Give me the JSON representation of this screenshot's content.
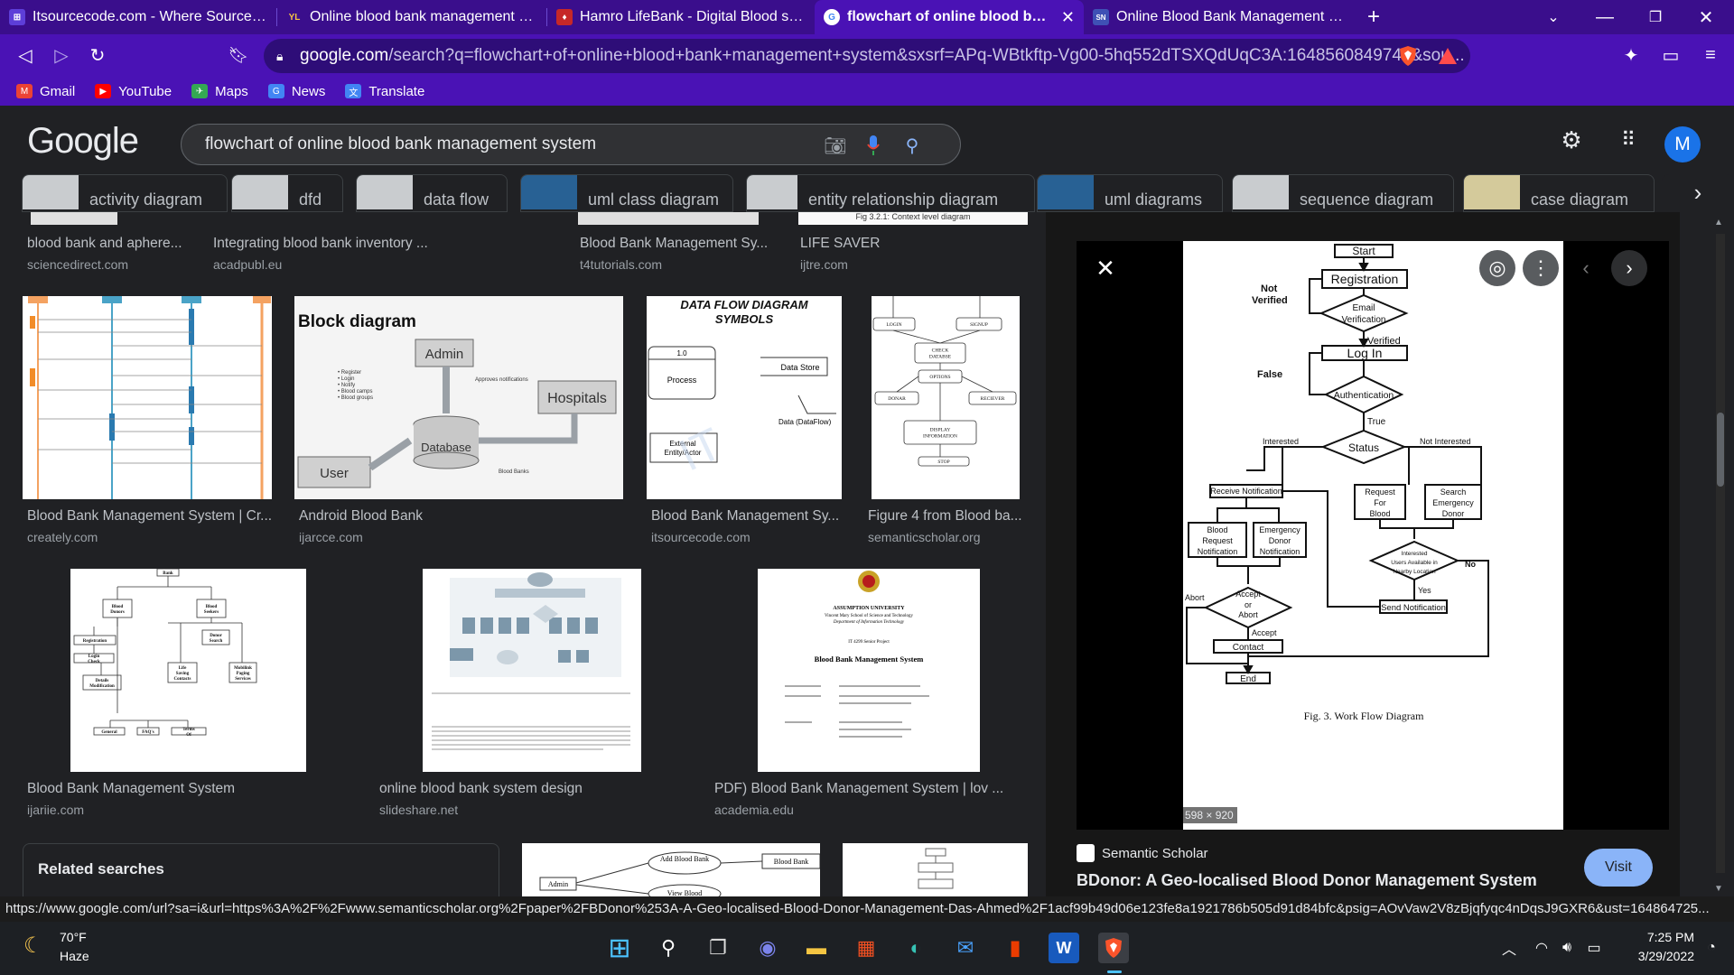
{
  "browser": {
    "tabs": [
      {
        "title": "Itsourcecode.com - Where Source Coc",
        "active": false,
        "fav": "⊞",
        "favcolor": "#5d3ed8"
      },
      {
        "title": "Online blood bank management syste",
        "active": false,
        "fav": "YL",
        "favcolor": "#f6c343"
      },
      {
        "title": "Hamro LifeBank - Digital Blood system",
        "active": false,
        "fav": "♦",
        "favcolor": "#e53935"
      },
      {
        "title": "flowchart of online blood bank m",
        "active": true,
        "fav": "G",
        "favcolor": "#ffffff"
      },
      {
        "title": "Online Blood Bank Management Syste",
        "active": false,
        "fav": "SN",
        "favcolor": "#3f51b5"
      }
    ],
    "new_tab": "+",
    "address_host": "google.com",
    "address_path": "/search?q=flowchart+of+online+blood+bank+management+system&sxsrf=APq-WBtkftp-Vg00-5hq552dTSXQdUqC3A:1648560849742&sou...",
    "bookmarks": [
      {
        "label": "Gmail",
        "icon": "gmail-icon",
        "color": "#ea4335"
      },
      {
        "label": "YouTube",
        "icon": "youtube-icon",
        "color": "#ff0000"
      },
      {
        "label": "Maps",
        "icon": "maps-icon",
        "color": "#34a853"
      },
      {
        "label": "News",
        "icon": "news-icon",
        "color": "#4285f4"
      },
      {
        "label": "Translate",
        "icon": "translate-icon",
        "color": "#4285f4"
      }
    ]
  },
  "google": {
    "logo": "Google",
    "query": "flowchart of  online blood bank management system",
    "avatar": "M",
    "chips": [
      "activity diagram",
      "dfd",
      "data flow",
      "uml class diagram",
      "entity relationship diagram",
      "uml diagrams",
      "sequence diagram",
      "case diagram"
    ]
  },
  "results": {
    "row0": [
      {
        "caption": "blood bank and aphere...",
        "source": "sciencedirect.com"
      },
      {
        "caption": "Integrating blood bank inventory ...",
        "source": "acadpubl.eu"
      },
      {
        "caption": "Blood Bank Management Sy...",
        "source": "t4tutorials.com"
      },
      {
        "caption": "LIFE SAVER",
        "source": "ijtre.com"
      }
    ],
    "row1": [
      {
        "caption": "Blood Bank Management System | Cr...",
        "source": "creately.com"
      },
      {
        "caption": "Android Blood Bank",
        "source": "ijarcce.com"
      },
      {
        "caption": "Blood Bank Management Sy...",
        "source": "itsourcecode.com"
      },
      {
        "caption": "Figure 4 from Blood ba...",
        "source": "semanticscholar.org"
      }
    ],
    "row2": [
      {
        "caption": "Blood Bank Management System",
        "source": "ijariie.com"
      },
      {
        "caption": "online blood bank system design",
        "source": "slideshare.net"
      },
      {
        "caption": "PDF) Blood Bank Management System | lov ...",
        "source": "academia.edu"
      }
    ],
    "related": "Related searches",
    "top_strip_text": "Fig 3.2.1: Context level diagram"
  },
  "thumbs": {
    "block": {
      "title": "Block diagram",
      "admin": "Admin",
      "hospitals": "Hospitals",
      "user": "User",
      "database": "Database",
      "list": [
        "Register",
        "Login",
        "Notify",
        "Blood camps",
        "Blood groups"
      ],
      "approves": "Approves notifications",
      "banks": "Blood Banks"
    },
    "dfd": {
      "title1": "DATA FLOW DIAGRAM",
      "title2": "SYMBOLS",
      "n10": "1.0",
      "process": "Process",
      "store": "Data Store",
      "flow": "Data (DataFlow)",
      "ext1": "External",
      "ext2": "Entity/Actor"
    },
    "fig4": [
      "LOGIN",
      "SIGNUP",
      "CHECK DATABSE",
      "OPTIONS",
      "DONAR",
      "RECIEVER",
      "DISPLAY INFORMATION",
      "STOP"
    ],
    "tree": [
      "Bank",
      "Blood Donors",
      "Blood Seekers",
      "Registration",
      "Donor Search",
      "Login Check",
      "Life Saving Contacts",
      "Mobilink Paging Services",
      "Details Modification",
      "General",
      "FAQ's",
      "Terms Of"
    ],
    "academia": [
      "ASSUMPTION UNIVERSITY",
      "Vincent Mary School of Science and Technology",
      "Department of Information Technology",
      "IT 4299 Senior Project",
      "Blood Bank Management System"
    ],
    "bottom": [
      "Add Blood Bank",
      "Blood Bank",
      "Admin",
      "View Blood"
    ]
  },
  "panel": {
    "dims": "598 × 920",
    "source": "Semantic Scholar",
    "title": "BDonor: A Geo-localised Blood Donor Management System",
    "visit": "Visit",
    "flow": {
      "start": "Start",
      "registration": "Registration",
      "not_verified": "Not Verified",
      "email1": "Email",
      "email2": "Verification",
      "verified": "Verified",
      "login": "Log In",
      "false": "False",
      "auth": "Authentication",
      "true": "True",
      "interested": "Interested",
      "status": "Status",
      "not_interested": "Not Interested",
      "receive": "Receive Notification",
      "request1": "Request",
      "request2": "For",
      "request3": "Blood",
      "search1": "Search",
      "search2": "Emergency",
      "search3": "Donor",
      "brn1": "Blood",
      "brn2": "Request",
      "brn3": "Notification",
      "edn1": "Emergency",
      "edn2": "Donor",
      "edn3": "Notification",
      "avail1": "Interested",
      "avail2": "Users Available in",
      "avail3": "Nearby Location",
      "no": "No",
      "yes": "Yes",
      "abort": "Abort",
      "acc1": "Accept",
      "acc2": "or",
      "acc3": "Abort",
      "accept": "Accept",
      "send": "Send Notification",
      "contact": "Contact",
      "end": "End",
      "caption": "Fig. 3.  Work Flow Diagram"
    }
  },
  "status_url": "https://www.google.com/url?sa=i&url=https%3A%2F%2Fwww.semanticscholar.org%2Fpaper%2FBDonor%253A-A-Geo-localised-Blood-Donor-Management-Das-Ahmed%2F1acf99b49d06e123fe8a1921786b505d91d84bfc&psig=AOvVaw2V8zBjqfyqc4nDqsJ9GXR6&ust=164864725...",
  "taskbar": {
    "temp": "70°F",
    "weather": "Haze",
    "time": "7:25 PM",
    "date": "3/29/2022"
  },
  "colors": {
    "tab_bg": "#3a0e8c",
    "toolbar": "#4a12b5",
    "accent": "#8ab4f8"
  }
}
